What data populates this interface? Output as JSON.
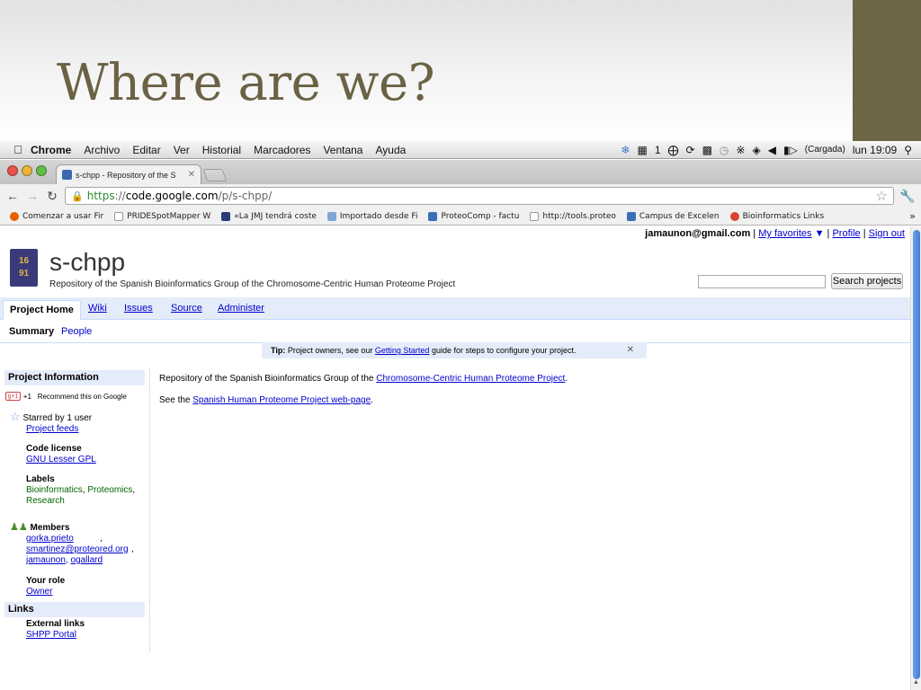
{
  "slide": {
    "title": "Where are we?"
  },
  "menubar": {
    "app": "Chrome",
    "items": [
      "Archivo",
      "Editar",
      "Ver",
      "Historial",
      "Marcadores",
      "Ventana",
      "Ayuda"
    ],
    "status": {
      "spaces": "1",
      "battery": "(Cargada)",
      "clock": "lun 19:09"
    }
  },
  "tab": {
    "title": "s-chpp - Repository of the S"
  },
  "toolbar": {
    "url_scheme": "https",
    "url_sep": "://",
    "url_host": "code.google.com",
    "url_path": "/p/s-chpp/"
  },
  "bookmarks": [
    "Comenzar a usar Fir",
    "PRIDESpotMapper W",
    "«La JMJ tendrá coste",
    "Importado desde Fi",
    "ProteoComp - factu",
    "http://tools.proteo",
    "Campus de Excelen",
    "Bioinformatics Links"
  ],
  "userbar": {
    "email": "jamaunon@gmail.com",
    "favorites": "My favorites",
    "profile": "Profile",
    "signout": "Sign out"
  },
  "project": {
    "logo_top": "16",
    "logo_bottom": "91",
    "name": "s-chpp",
    "summary": "Repository of the Spanish Bioinformatics Group of the Chromosome-Centric Human Proteome Project"
  },
  "search": {
    "button": "Search projects",
    "value": ""
  },
  "tabs": {
    "home": "Project Home",
    "wiki": "Wiki",
    "issues": "Issues",
    "source": "Source",
    "administer": "Administer"
  },
  "subtabs": {
    "summary": "Summary",
    "people": "People"
  },
  "tip": {
    "label": "Tip:",
    "text1": " Project owners, see our ",
    "link": "Getting Started",
    "text2": " guide for steps to configure your project."
  },
  "sidebar": {
    "info_header": "Project Information",
    "gplus_badge": "g+1",
    "plus_one": "+1",
    "recommend": "Recommend this on Google",
    "starred": "Starred by 1 user",
    "feeds": "Project feeds",
    "license_label": "Code license",
    "license": "GNU Lesser GPL",
    "labels_label": "Labels",
    "label1": "Bioinformatics",
    "label2": "Proteomics",
    "label3": "Research",
    "members_label": "Members",
    "member1": "gorka.prieto",
    "member2": "smartinez@proteored.org",
    "member3": "jamaunon",
    "member4": "ogallard",
    "role_label": "Your role",
    "role": "Owner",
    "links_header": "Links",
    "external_label": "External links",
    "external_link": "SHPP Portal"
  },
  "content": {
    "line1_text": "Repository of the Spanish Bioinformatics Group of the ",
    "line1_link": "Chromosome-Centric Human Proteome Project",
    "line2_text": "See the ",
    "line2_link": "Spanish Human Proteome Project web-page"
  }
}
